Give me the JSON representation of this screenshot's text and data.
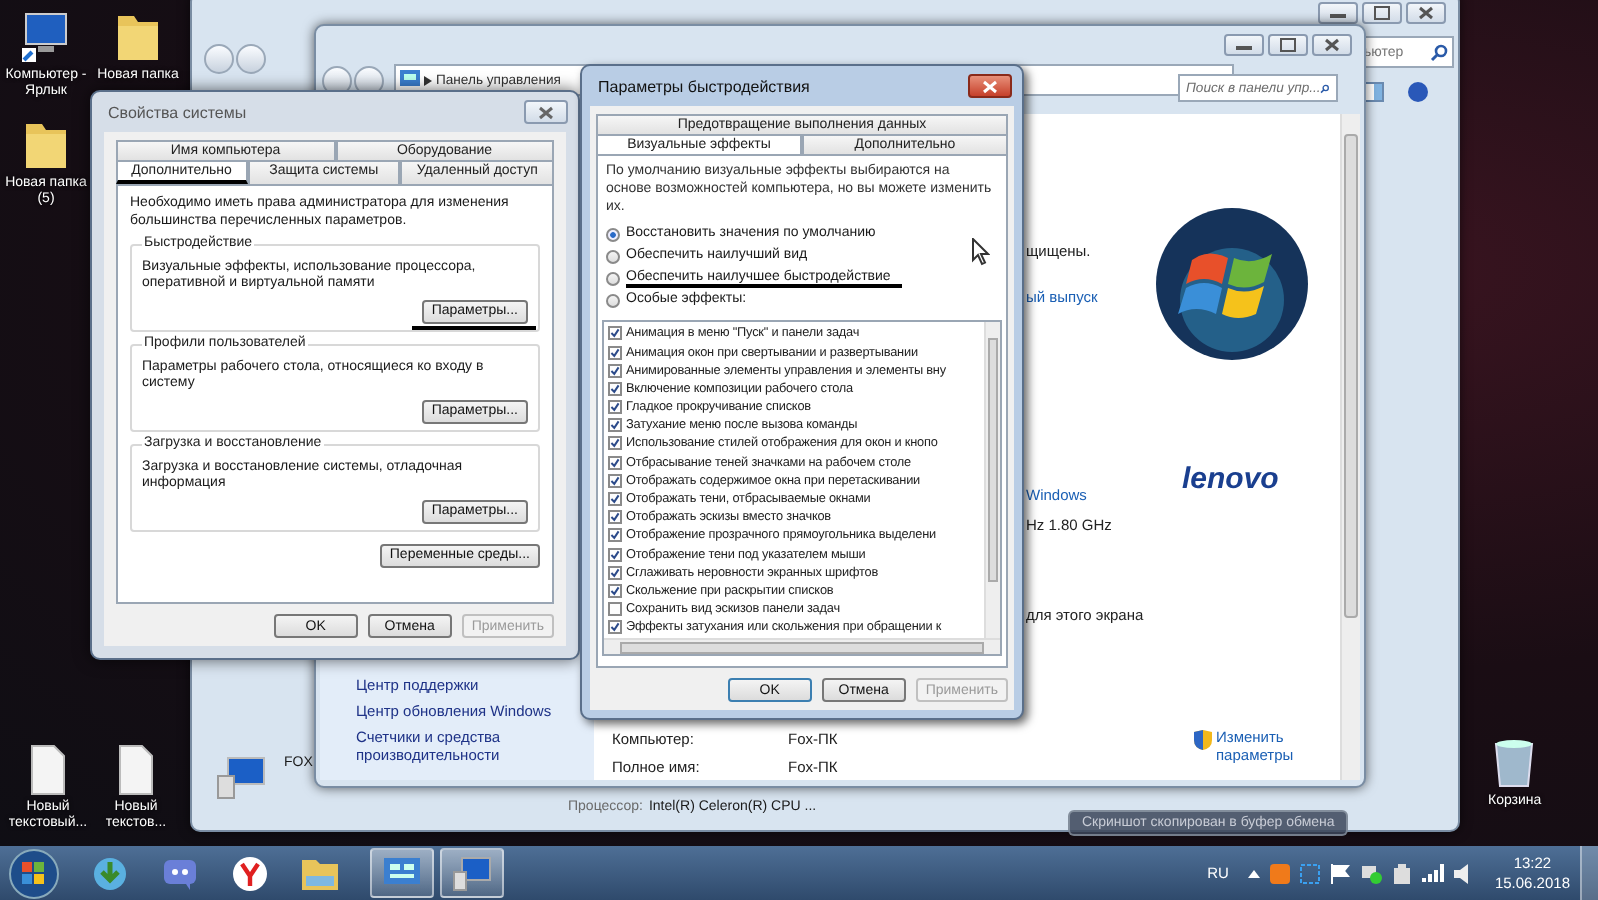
{
  "desktop": {
    "top_icons": [
      {
        "label": "Компьютер - Ярлык",
        "kind": "computer"
      },
      {
        "label": "Новая папка",
        "kind": "folder"
      },
      {
        "label": "Новая папка (5)",
        "kind": "folder"
      }
    ],
    "bottom_icons": [
      {
        "label": "Новый текстовый...",
        "kind": "text"
      },
      {
        "label": "Новый текстов...",
        "kind": "text"
      }
    ],
    "recycle_bin": {
      "label": "Корзина"
    }
  },
  "explorer_window": {
    "search": "ьютер",
    "computer_name": "FOX",
    "processor_label": "Процессор:",
    "processor_value": "Intel(R) Celeron(R) CPU ..."
  },
  "control_panel": {
    "address": "Панель управления",
    "search_placeholder": "Поиск в панели упр...",
    "fragments": [
      {
        "text": "щищены.",
        "kind": "text"
      },
      {
        "text": "ый выпуск",
        "kind": "link"
      },
      {
        "text": "Windows",
        "kind": "link"
      },
      {
        "text": "Hz  1.80 GHz",
        "kind": "text"
      },
      {
        "text": "для этого экрана",
        "kind": "text"
      }
    ],
    "sidebar_links": [
      "Центр поддержки",
      "Центр обновления Windows",
      "Счетчики и средства производительности"
    ],
    "rows": [
      {
        "label": "Компьютер:",
        "value": "Fox-ПК"
      },
      {
        "label": "Полное имя:",
        "value": "Fox-ПК"
      }
    ],
    "change_link": "Изменить параметры",
    "logo_text": "lenovo"
  },
  "system_properties": {
    "title": "Свойства системы",
    "tabs_row1": [
      {
        "label": "Имя компьютера",
        "selected": false
      },
      {
        "label": "Оборудование",
        "selected": false
      }
    ],
    "tabs_row2": [
      {
        "label": "Дополнительно",
        "selected": true,
        "underlined": true
      },
      {
        "label": "Защита системы",
        "selected": false,
        "underlined": false
      },
      {
        "label": "Удаленный доступ",
        "selected": false,
        "underlined": false
      }
    ],
    "intro": "Необходимо иметь права администратора для изменения большинства перечисленных параметров.",
    "groups": [
      {
        "title": "Быстродействие",
        "text": "Визуальные эффекты, использование процессора, оперативной и виртуальной памяти",
        "button": "Параметры...",
        "underlined": true
      },
      {
        "title": "Профили пользователей",
        "text": "Параметры рабочего стола, относящиеся ко входу в систему",
        "button": "Параметры...",
        "underlined": false
      },
      {
        "title": "Загрузка и восстановление",
        "text": "Загрузка и восстановление системы, отладочная информация",
        "button": "Параметры...",
        "underlined": false
      }
    ],
    "env_button": "Переменные среды...",
    "buttons": [
      {
        "label": "OK",
        "disabled": false
      },
      {
        "label": "Отмена",
        "disabled": false
      },
      {
        "label": "Применить",
        "disabled": true
      }
    ]
  },
  "performance_options": {
    "title": "Параметры быстродействия",
    "tabs_row1": [
      {
        "label": "Предотвращение выполнения данных",
        "selected": false
      }
    ],
    "tabs_row2": [
      {
        "label": "Визуальные эффекты",
        "selected": true
      },
      {
        "label": "Дополнительно",
        "selected": false
      }
    ],
    "description": "По умолчанию визуальные эффекты выбираются на основе возможностей компьютера, но вы можете изменить их.",
    "options": [
      {
        "label": "Восстановить значения по умолчанию",
        "selected": true,
        "underlined": false
      },
      {
        "label": "Обеспечить наилучший вид",
        "selected": false,
        "underlined": false
      },
      {
        "label": "Обеспечить наилучшее быстродействие",
        "selected": false,
        "underlined": true
      },
      {
        "label": "Особые эффекты:",
        "selected": false,
        "underlined": false
      }
    ],
    "effects": [
      {
        "label": "Анимация в меню \"Пуск\" и панели задач",
        "checked": true
      },
      {
        "label": "Анимация окон при свертывании и развертывании",
        "checked": true
      },
      {
        "label": "Анимированные элементы управления и элементы вну",
        "checked": true
      },
      {
        "label": "Включение композиции рабочего стола",
        "checked": true
      },
      {
        "label": "Гладкое прокручивание списков",
        "checked": true
      },
      {
        "label": "Затухание меню после вызова команды",
        "checked": true
      },
      {
        "label": "Использование стилей отображения для окон и кнопо",
        "checked": true
      },
      {
        "label": "Отбрасывание теней значками на рабочем столе",
        "checked": true
      },
      {
        "label": "Отображать содержимое окна при перетаскивании",
        "checked": true
      },
      {
        "label": "Отображать тени, отбрасываемые окнами",
        "checked": true
      },
      {
        "label": "Отображать эскизы вместо значков",
        "checked": true
      },
      {
        "label": "Отображение прозрачного прямоугольника выделени",
        "checked": true
      },
      {
        "label": "Отображение тени под указателем мыши",
        "checked": true
      },
      {
        "label": "Сглаживать неровности экранных шрифтов",
        "checked": true
      },
      {
        "label": "Скольжение при раскрытии списков",
        "checked": true
      },
      {
        "label": "Сохранить вид эскизов панели задач",
        "checked": false
      },
      {
        "label": "Эффекты затухания или скольжения при обращении к",
        "checked": true
      }
    ],
    "buttons": [
      {
        "label": "OK",
        "disabled": false
      },
      {
        "label": "Отмена",
        "disabled": false
      },
      {
        "label": "Применить",
        "disabled": true
      }
    ]
  },
  "toast": "Скриншот скопирован в буфер обмена",
  "taskbar": {
    "apps": [
      {
        "kind": "download",
        "active": false
      },
      {
        "kind": "chat",
        "active": false
      },
      {
        "kind": "browser",
        "active": false
      },
      {
        "kind": "folder",
        "active": false
      },
      {
        "kind": "control-panel",
        "active": true
      },
      {
        "kind": "system",
        "active": true
      }
    ],
    "language": "RU",
    "time": "13:22",
    "date": "15.06.2018"
  }
}
